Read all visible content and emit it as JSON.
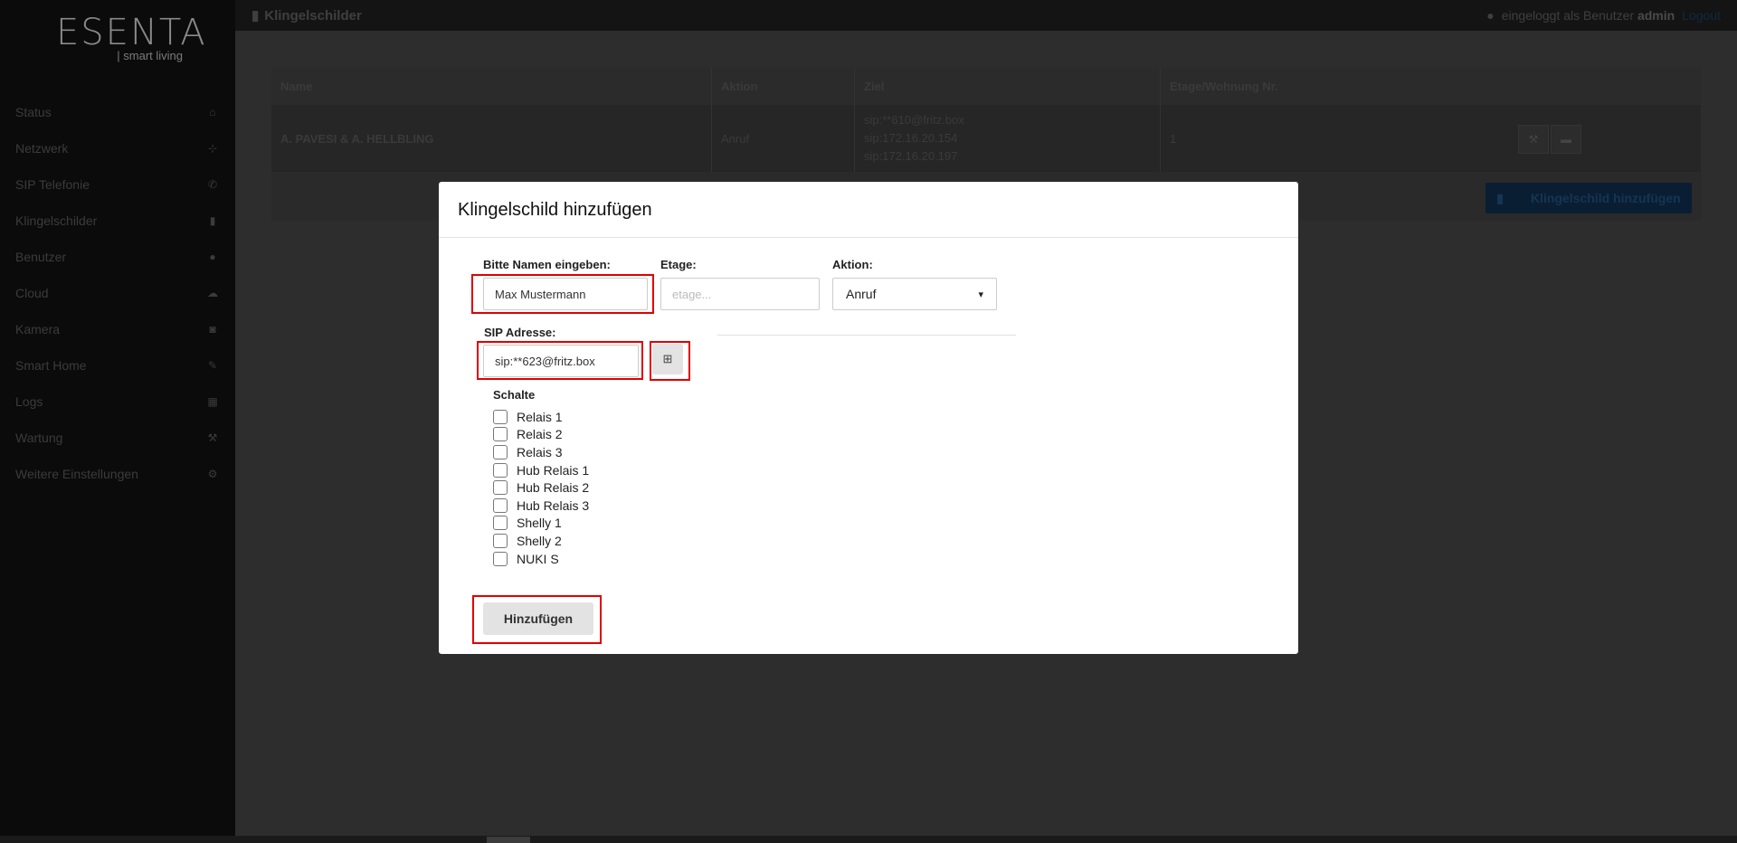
{
  "logo": {
    "main": "ESENTA",
    "sub": "| smart living"
  },
  "sidebar": {
    "items": [
      {
        "label": "Status",
        "icon": "home-icon"
      },
      {
        "label": "Netzwerk",
        "icon": "sitemap-icon"
      },
      {
        "label": "SIP Telefonie",
        "icon": "phone-icon"
      },
      {
        "label": "Klingelschilder",
        "icon": "book-icon"
      },
      {
        "label": "Benutzer",
        "icon": "users-icon"
      },
      {
        "label": "Cloud",
        "icon": "cloud-icon"
      },
      {
        "label": "Kamera",
        "icon": "camera-icon"
      },
      {
        "label": "Smart Home",
        "icon": "wand-icon"
      },
      {
        "label": "Logs",
        "icon": "calendar-icon"
      },
      {
        "label": "Wartung",
        "icon": "wrench-icon"
      },
      {
        "label": "Weitere Einstellungen",
        "icon": "gears-icon"
      }
    ]
  },
  "header": {
    "title": "Klingelschilder",
    "logged_in_prefix": "eingeloggt als Benutzer",
    "user": "admin",
    "logout": "Logout"
  },
  "table": {
    "columns": [
      "Name",
      "Aktion",
      "Ziel",
      "Etage/Wohnung Nr."
    ],
    "rows": [
      {
        "name": "A. PAVESI & A. HELLBLING",
        "aktion": "Anruf",
        "ziel": [
          "sip:**610@fritz.box",
          "sip:172.16.20.154",
          "sip:172.16.20.197"
        ],
        "etage": "1"
      }
    ],
    "add_button": "Klingelschild hinzufügen"
  },
  "modal": {
    "title": "Klingelschild hinzufügen",
    "name_label": "Bitte Namen eingeben:",
    "name_value": "Max Mustermann",
    "etage_label": "Etage:",
    "etage_placeholder": "etage...",
    "aktion_label": "Aktion:",
    "aktion_value": "Anruf",
    "sip_label": "SIP Adresse:",
    "sip_value": "sip:**623@fritz.box",
    "add_sip_icon": "plus-square-icon",
    "schalte_label": "Schalte",
    "schalte": [
      "Relais 1",
      "Relais 2",
      "Relais 3",
      "Hub Relais 1",
      "Hub Relais 2",
      "Hub Relais 3",
      "Shelly 1",
      "Shelly 2",
      "NUKI S"
    ],
    "submit": "Hinzufügen"
  },
  "colors": {
    "highlight": "#e00000",
    "overlay": "#2e2e2e",
    "modal_bg": "#ffffff"
  }
}
